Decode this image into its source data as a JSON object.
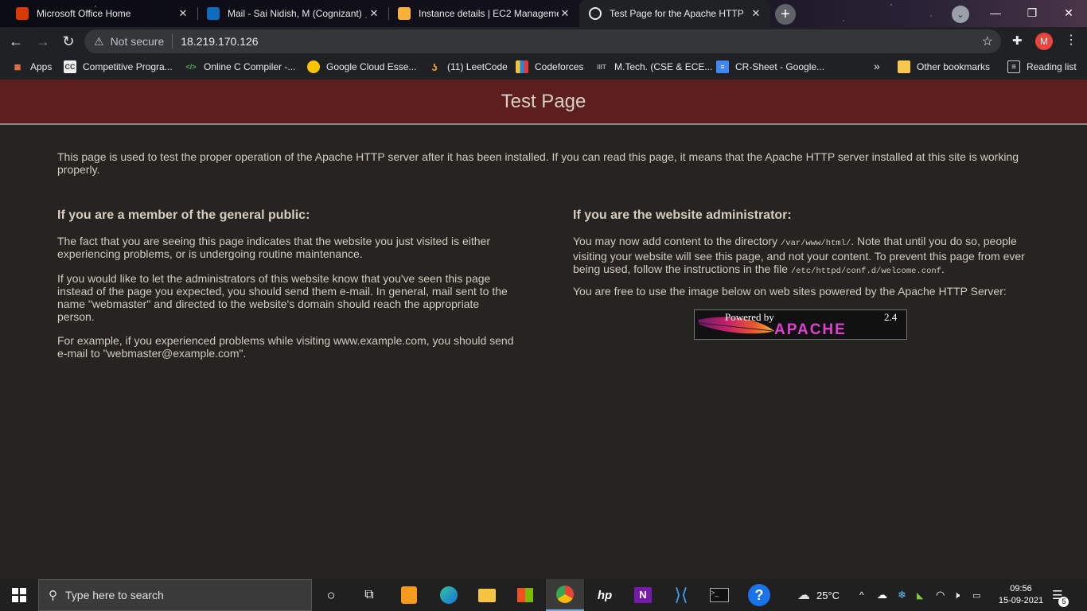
{
  "browser": {
    "tabs": [
      {
        "title": "Microsoft Office Home",
        "icon": "office-icon",
        "color": "#d83b01"
      },
      {
        "title": "Mail - Sai Nidish, M (Cognizant)",
        "icon": "outlook-icon",
        "color": "#0f6cbd"
      },
      {
        "title": "Instance details | EC2 Manageme",
        "icon": "aws-icon",
        "color": "#f7b23b"
      },
      {
        "title": "Test Page for the Apache HTTP",
        "icon": "globe-icon",
        "color": "#e8eaed"
      }
    ],
    "address": {
      "security_label": "Not secure",
      "url": "18.219.170.126"
    },
    "profile_initial": "M",
    "bookmarks": [
      {
        "label": "Apps",
        "icon": "apps-grid-icon"
      },
      {
        "label": "Competitive Progra...",
        "icon": "codechef-icon",
        "badge": "CC"
      },
      {
        "label": "Online C Compiler -...",
        "icon": "code-icon",
        "badge": "</>"
      },
      {
        "label": "Google Cloud Esse...",
        "icon": "google-cloud-icon"
      },
      {
        "label": "(11) LeetCode",
        "icon": "leetcode-icon"
      },
      {
        "label": "Codeforces",
        "icon": "codeforces-icon"
      },
      {
        "label": "M.Tech. (CSE & ECE...",
        "icon": "iiit-icon",
        "badge": "IIIT"
      },
      {
        "label": "CR-Sheet - Google...",
        "icon": "google-docs-icon"
      },
      {
        "label": "Other bookmarks",
        "icon": "folder-icon"
      },
      {
        "label": "Reading list",
        "icon": "reading-list-icon"
      }
    ],
    "more_bookmarks": "»"
  },
  "page": {
    "title": "Test Page",
    "intro": "This page is used to test the proper operation of the Apache HTTP server after it has been installed. If you can read this page, it means that the Apache HTTP server installed at this site is working properly.",
    "left": {
      "heading": "If you are a member of the general public:",
      "p1": "The fact that you are seeing this page indicates that the website you just visited is either experiencing problems, or is undergoing routine maintenance.",
      "p2": "If you would like to let the administrators of this website know that you've seen this page instead of the page you expected, you should send them e-mail. In general, mail sent to the name \"webmaster\" and directed to the website's domain should reach the appropriate person.",
      "p3": "For example, if you experienced problems while visiting www.example.com, you should send e-mail to \"webmaster@example.com\"."
    },
    "right": {
      "heading": "If you are the website administrator:",
      "p1_a": "You may now add content to the directory ",
      "p1_code1": "/var/www/html/",
      "p1_b": ". Note that until you do so, people visiting your website will see this page, and not your content. To prevent this page from ever being used, follow the instructions in the file ",
      "p1_code2": "/etc/httpd/conf.d/welcome.conf",
      "p1_c": ".",
      "p2": "You are free to use the image below on web sites powered by the Apache HTTP Server:",
      "badge": {
        "powered": "Powered by",
        "name": "APACHE",
        "version": "2.4"
      }
    }
  },
  "taskbar": {
    "search_placeholder": "Type here to search",
    "weather": "25°C",
    "time": "09:56",
    "date": "15-09-2021",
    "notifications": "5"
  }
}
